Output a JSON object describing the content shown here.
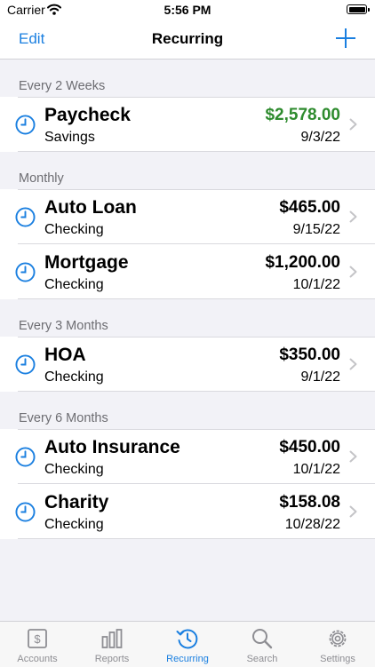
{
  "status": {
    "carrier": "Carrier",
    "time": "5:56 PM"
  },
  "nav": {
    "edit_label": "Edit",
    "title": "Recurring"
  },
  "colors": {
    "accent": "#1a7fe0",
    "positive": "#2e8b2e"
  },
  "sections": [
    {
      "header": "Every 2 Weeks",
      "items": [
        {
          "name": "Paycheck",
          "account": "Savings",
          "amount": "$2,578.00",
          "date": "9/3/22",
          "positive": true
        }
      ]
    },
    {
      "header": "Monthly",
      "items": [
        {
          "name": "Auto Loan",
          "account": "Checking",
          "amount": "$465.00",
          "date": "9/15/22"
        },
        {
          "name": "Mortgage",
          "account": "Checking",
          "amount": "$1,200.00",
          "date": "10/1/22"
        }
      ]
    },
    {
      "header": "Every 3 Months",
      "items": [
        {
          "name": "HOA",
          "account": "Checking",
          "amount": "$350.00",
          "date": "9/1/22"
        }
      ]
    },
    {
      "header": "Every 6 Months",
      "items": [
        {
          "name": "Auto Insurance",
          "account": "Checking",
          "amount": "$450.00",
          "date": "10/1/22"
        },
        {
          "name": "Charity",
          "account": "Checking",
          "amount": "$158.08",
          "date": "10/28/22"
        }
      ]
    }
  ],
  "tabs": [
    {
      "label": "Accounts",
      "icon": "accounts-icon"
    },
    {
      "label": "Reports",
      "icon": "reports-icon"
    },
    {
      "label": "Recurring",
      "icon": "recurring-icon",
      "active": true
    },
    {
      "label": "Search",
      "icon": "search-icon"
    },
    {
      "label": "Settings",
      "icon": "settings-icon"
    }
  ]
}
